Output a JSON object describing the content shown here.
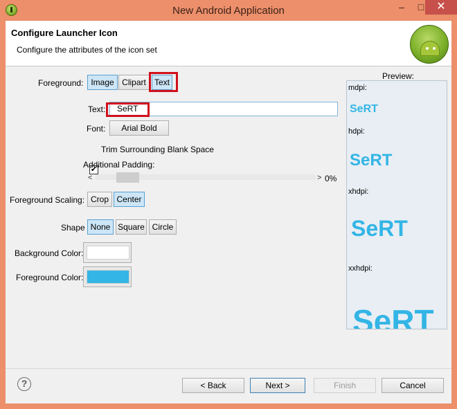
{
  "window": {
    "title": "New Android Application",
    "min_glyph": "–",
    "max_glyph": "□",
    "close_glyph": "✕"
  },
  "header": {
    "title": "Configure Launcher Icon",
    "subtitle": "Configure the attributes of the icon set"
  },
  "foreground": {
    "label": "Foreground:",
    "options": [
      "Image",
      "Clipart",
      "Text"
    ],
    "selected": "Text"
  },
  "text_field": {
    "label": "Text:",
    "value": "SeRT"
  },
  "font": {
    "label": "Font:",
    "value": "Arial Bold"
  },
  "trim": {
    "label": "Trim Surrounding Blank Space",
    "checked": true,
    "check_glyph": "✔"
  },
  "padding": {
    "label": "Additional Padding:",
    "value_text": "0%",
    "value": 0,
    "left_arrow": "<",
    "right_arrow": ">"
  },
  "scaling": {
    "label": "Foreground Scaling:",
    "options": [
      "Crop",
      "Center"
    ],
    "selected": "Center"
  },
  "shape": {
    "label": "Shape",
    "options": [
      "None",
      "Square",
      "Circle"
    ],
    "selected": "None"
  },
  "background_color": {
    "label": "Background Color:",
    "value": "#ffffff"
  },
  "foreground_color": {
    "label": "Foreground Color:",
    "value": "#33b5e5"
  },
  "preview": {
    "label": "Preview:",
    "text": "SeRT",
    "densities": [
      "mdpi:",
      "hdpi:",
      "xhdpi:",
      "xxhdpi:"
    ]
  },
  "footer": {
    "help_glyph": "?",
    "back": "< Back",
    "next": "Next >",
    "finish": "Finish",
    "cancel": "Cancel"
  }
}
